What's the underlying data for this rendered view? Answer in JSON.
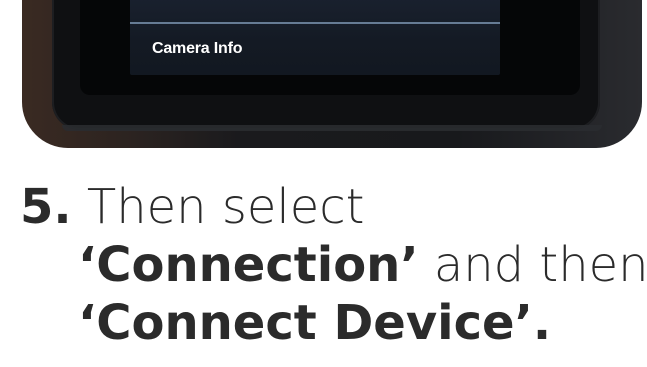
{
  "photo": {
    "screen_label": "Camera Info"
  },
  "instruction": {
    "step_number": "5.",
    "line1_text": " Then select",
    "line2_open_quote": "‘",
    "line2_bold": "Connection",
    "line2_close_quote": "’",
    "line2_text": " and then",
    "line3_open_quote": "‘",
    "line3_bold": "Connect Device",
    "line3_close_quote": "’."
  }
}
